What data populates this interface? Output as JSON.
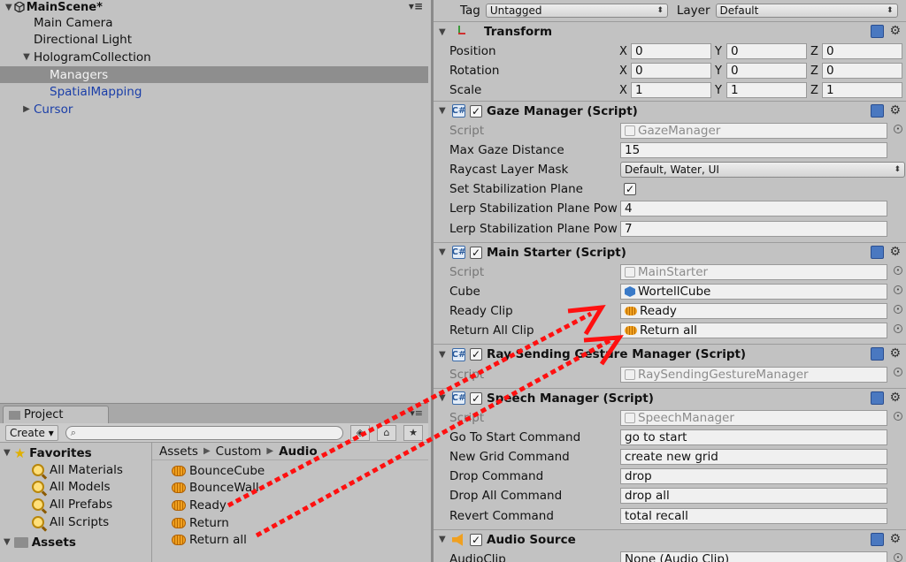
{
  "hierarchy": {
    "scene_name": "MainScene*",
    "items": [
      {
        "label": "Main Camera",
        "indent": 1,
        "fold": ""
      },
      {
        "label": "Directional Light",
        "indent": 1,
        "fold": ""
      },
      {
        "label": "HologramCollection",
        "indent": 1,
        "fold": "▼"
      },
      {
        "label": "Managers",
        "indent": 2,
        "fold": "",
        "selected": true
      },
      {
        "label": "SpatialMapping",
        "indent": 2,
        "fold": "",
        "prefab": true
      },
      {
        "label": "Cursor",
        "indent": 1,
        "fold": "▶",
        "prefab": true
      }
    ]
  },
  "project": {
    "tab_label": "Project",
    "create_label": "Create",
    "favorites_label": "Favorites",
    "favorites": [
      "All Materials",
      "All Models",
      "All Prefabs",
      "All Scripts"
    ],
    "assets_label": "Assets",
    "breadcrumb": [
      "Assets",
      "Custom",
      "Audio"
    ],
    "audio_assets": [
      "BounceCube",
      "BounceWall",
      "Ready",
      "Return",
      "Return all"
    ]
  },
  "inspector": {
    "tag_label": "Tag",
    "tag_value": "Untagged",
    "layer_label": "Layer",
    "layer_value": "Default",
    "transform": {
      "title": "Transform",
      "rows": [
        {
          "label": "Position",
          "x": "0",
          "y": "0",
          "z": "0"
        },
        {
          "label": "Rotation",
          "x": "0",
          "y": "0",
          "z": "0"
        },
        {
          "label": "Scale",
          "x": "1",
          "y": "1",
          "z": "1"
        }
      ],
      "axis_x": "X",
      "axis_y": "Y",
      "axis_z": "Z"
    },
    "gaze_manager": {
      "title": "Gaze Manager (Script)",
      "script_label": "Script",
      "script_value": "GazeManager",
      "max_gaze_label": "Max Gaze Distance",
      "max_gaze_value": "15",
      "raycast_label": "Raycast Layer Mask",
      "raycast_value": "Default, Water, UI",
      "stabilization_label": "Set Stabilization Plane",
      "lerp1_label": "Lerp Stabilization Plane Pow",
      "lerp1_value": "4",
      "lerp2_label": "Lerp Stabilization Plane Pow",
      "lerp2_value": "7"
    },
    "main_starter": {
      "title": "Main Starter (Script)",
      "script_label": "Script",
      "script_value": "MainStarter",
      "cube_label": "Cube",
      "cube_value": "WortellCube",
      "ready_label": "Ready Clip",
      "ready_value": "Ready",
      "return_label": "Return All Clip",
      "return_value": "Return all"
    },
    "ray_sending": {
      "title": "Ray Sending Gesture Manager (Script)",
      "script_label": "Script",
      "script_value": "RaySendingGestureManager"
    },
    "speech_manager": {
      "title": "Speech Manager (Script)",
      "script_label": "Script",
      "script_value": "SpeechManager",
      "rows": [
        {
          "label": "Go To Start Command",
          "value": "go to start"
        },
        {
          "label": "New Grid Command",
          "value": "create new grid"
        },
        {
          "label": "Drop Command",
          "value": "drop"
        },
        {
          "label": "Drop All Command",
          "value": "drop all"
        },
        {
          "label": "Revert Command",
          "value": "total recall"
        }
      ]
    },
    "audio_source": {
      "title": "Audio Source",
      "clip_label": "AudioClip",
      "clip_value": "None (Audio Clip)"
    }
  },
  "annotation_color": "#ff1010"
}
